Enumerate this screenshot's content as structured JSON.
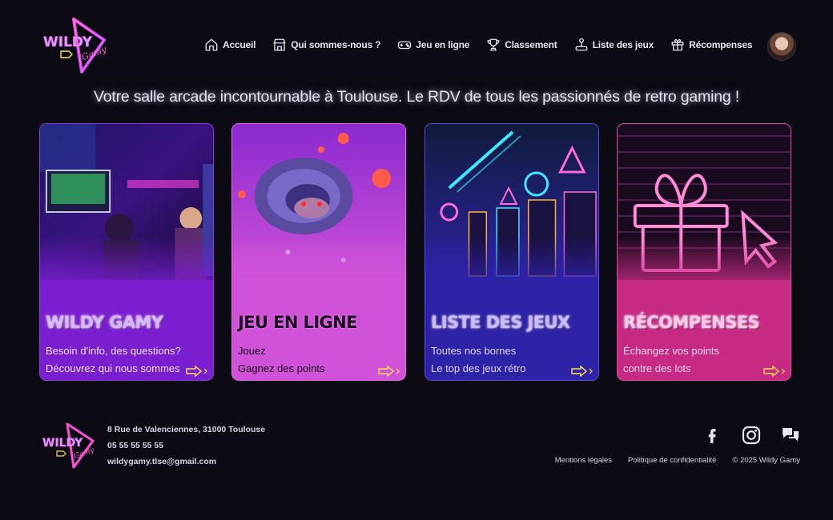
{
  "brand": {
    "logo_text": "WILDY",
    "logo_subtext": "Gamy"
  },
  "nav": [
    {
      "label": "Accueil",
      "icon": "home-icon"
    },
    {
      "label": "Qui sommes-nous ?",
      "icon": "store-icon"
    },
    {
      "label": "Jeu en ligne",
      "icon": "gamepad-icon"
    },
    {
      "label": "Classement",
      "icon": "trophy-icon"
    },
    {
      "label": "Liste des jeux",
      "icon": "joystick-icon"
    },
    {
      "label": "Récompenses",
      "icon": "gift-icon"
    }
  ],
  "tagline": "Votre salle arcade incontournable à Toulouse. Le RDV de tous les passionnés de retro gaming !",
  "cards": [
    {
      "title": "Wildy Gamy",
      "line1": "Besoin d'info, des questions?",
      "line2": "Découvrez qui nous sommes",
      "color": "#7a1fd0"
    },
    {
      "title": "Jeu en ligne",
      "line1": "Jouez",
      "line2": "Gagnez des points",
      "color": "#cf52d8"
    },
    {
      "title": "Liste des jeux",
      "line1": "Toutes nos bornes",
      "line2": "Le top des jeux rétro",
      "color": "#2e22a6"
    },
    {
      "title": "Récompenses",
      "line1": "Échangez vos points",
      "line2": "contre des lots",
      "color": "#c62a82"
    }
  ],
  "footer": {
    "address": "8 Rue de Valenciennes, 31000 Toulouse",
    "phone": "05 55 55 55 55",
    "email": "wildygamy.tlse@gmail.com",
    "social": [
      "facebook-icon",
      "instagram-icon",
      "chat-icon"
    ],
    "links": [
      "Mentions légales",
      "Politique de confidentialité",
      "© 2025 Wildy Gamy"
    ]
  }
}
